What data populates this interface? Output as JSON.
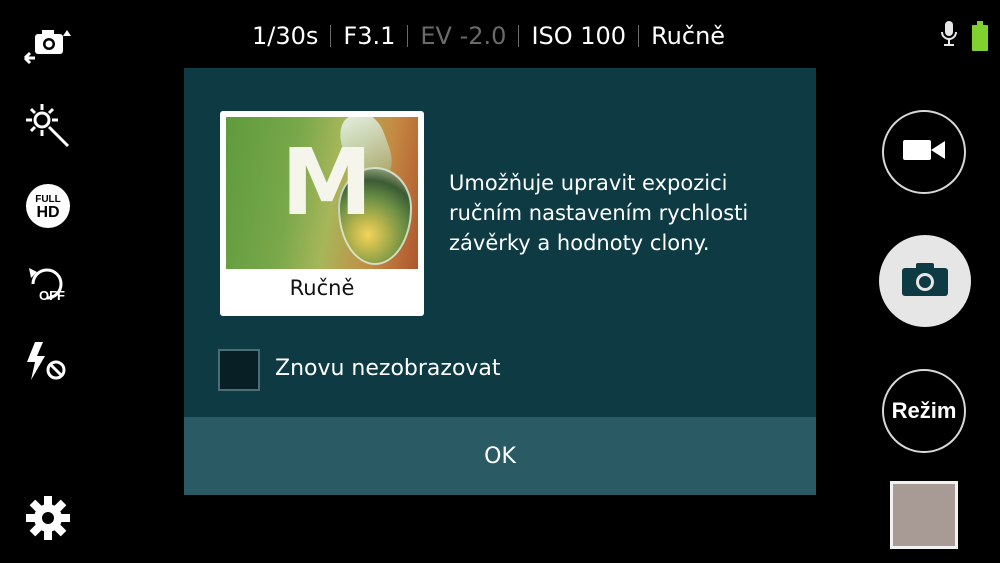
{
  "status_bar": {
    "shutter_speed": "1/30s",
    "aperture": "F3.1",
    "exposure": "EV -2.0",
    "iso": "ISO 100",
    "mode": "Ručně"
  },
  "right_controls": {
    "mode_button_label": "Režim"
  },
  "dialog": {
    "card_label": "Ručně",
    "card_letter": "M",
    "description": "Umožňuje upravit expozici ručním nastavením rychlosti závěrky a hodnoty clony.",
    "checkbox_label": "Znovu nezobrazovat",
    "checkbox_checked": false,
    "ok_label": "OK"
  },
  "left_toolbar_icons": [
    "switch-camera-icon",
    "effects-icon",
    "full-hd-icon",
    "timer-off-icon",
    "flash-off-icon",
    "settings-icon"
  ],
  "colors": {
    "dialog_bg": "#0d3a43",
    "ok_bar_bg": "#2a5a63",
    "battery": "#7fd12f"
  }
}
